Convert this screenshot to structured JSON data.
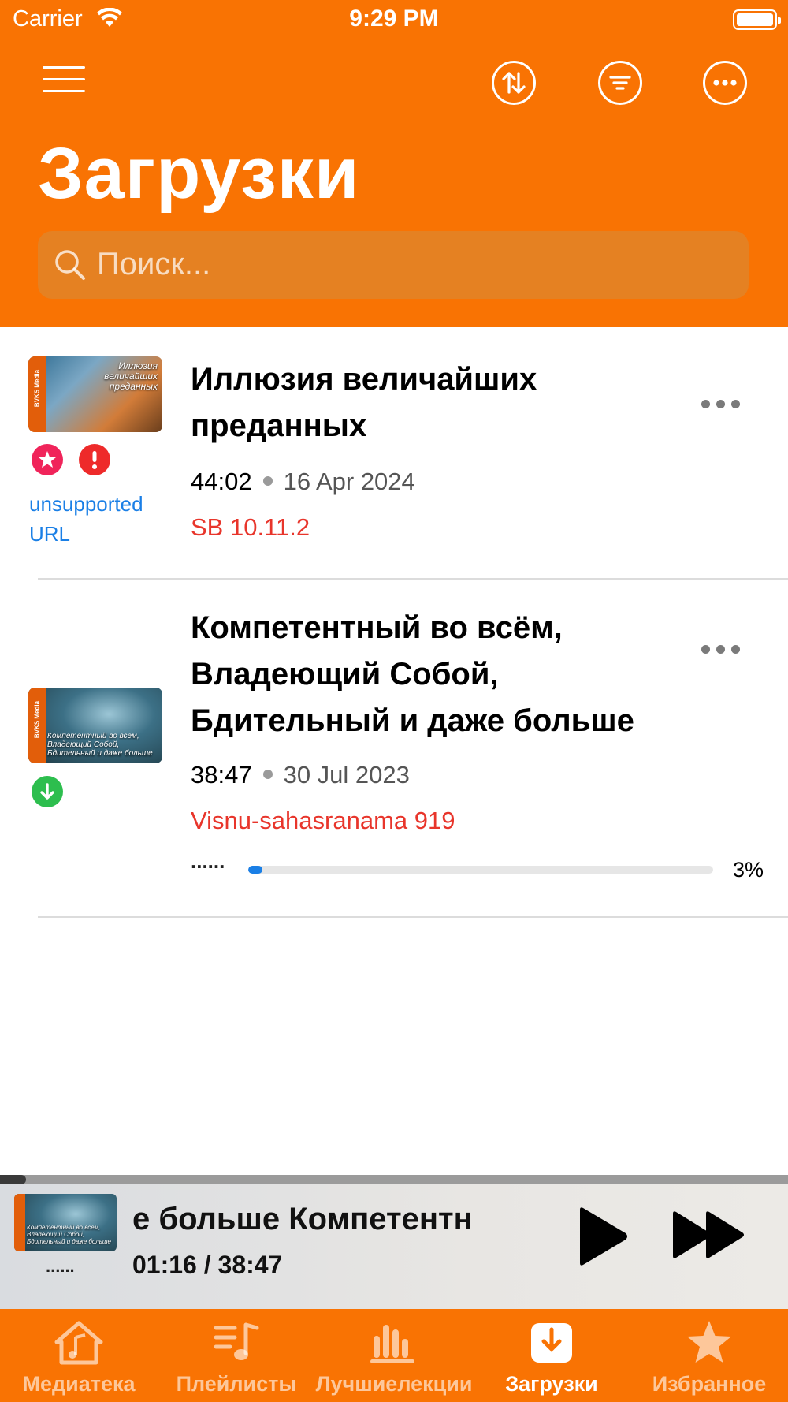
{
  "status_bar": {
    "carrier": "Carrier",
    "time": "9:29 PM"
  },
  "header": {
    "title": "Загрузки",
    "search_placeholder": "Поиск..."
  },
  "items": [
    {
      "title": "Иллюзия величайших преданных",
      "duration": "44:02",
      "date": "16 Apr 2024",
      "reference": "SB 10.11.2",
      "thumb_caption": "Иллюзия величайших преданных",
      "thumb_brand": "BVKS Media",
      "status_text": "unsupported URL",
      "badges": [
        "favorite-star",
        "error-exclamation"
      ]
    },
    {
      "title": "Компетентный во всём, Владеющий Собой, Бдительный и даже больше",
      "duration": "38:47",
      "date": "30 Jul 2023",
      "reference": "Visnu-sahasranama 919",
      "thumb_caption": "Компетентный во всем, Владеющий Собой, Бдительный и даже больше",
      "thumb_brand": "BVKS Media",
      "download_dots": "......",
      "download_progress": 0.03,
      "download_percent": "3%",
      "badges": [
        "downloading-arrow"
      ]
    }
  ],
  "player": {
    "title": "Компетентный во всём, Владеющий Собой, Бдительный и даже больше",
    "title_visible": "е больше      Компетентн",
    "elapsed": "01:16",
    "separator": "/",
    "total": "38:47",
    "dots": "......",
    "progress": 0.033,
    "thumb_caption": "Компетентный во всем, Владеющий Собой, Бдительный и даже больше"
  },
  "tabs": [
    {
      "label": "Медиатека",
      "icon": "home-music-icon",
      "active": false
    },
    {
      "label": "Плейлисты",
      "icon": "playlist-icon",
      "active": false
    },
    {
      "label": "Лучшиелекции",
      "icon": "bar-chart-icon",
      "active": false
    },
    {
      "label": "Загрузки",
      "icon": "download-tray-icon",
      "active": true
    },
    {
      "label": "Избранное",
      "icon": "star-icon",
      "active": false
    }
  ],
  "colors": {
    "brand_orange": "#F97303",
    "reference_red": "#E8352B",
    "link_blue": "#1A7FE6",
    "badge_pink": "#F0245A",
    "badge_red": "#EE2A2A",
    "badge_green": "#2DBE4E"
  }
}
